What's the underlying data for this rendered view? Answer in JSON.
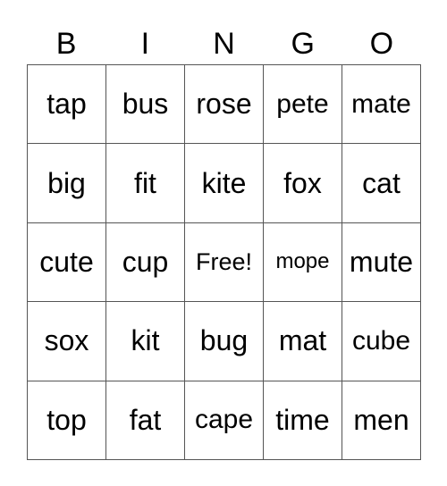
{
  "header": [
    "B",
    "I",
    "N",
    "G",
    "O"
  ],
  "rows": [
    [
      "tap",
      "bus",
      "rose",
      "pete",
      "mate"
    ],
    [
      "big",
      "fit",
      "kite",
      "fox",
      "cat"
    ],
    [
      "cute",
      "cup",
      "Free!",
      "mope",
      "mute"
    ],
    [
      "sox",
      "kit",
      "bug",
      "mat",
      "cube"
    ],
    [
      "top",
      "fat",
      "cape",
      "time",
      "men"
    ]
  ]
}
